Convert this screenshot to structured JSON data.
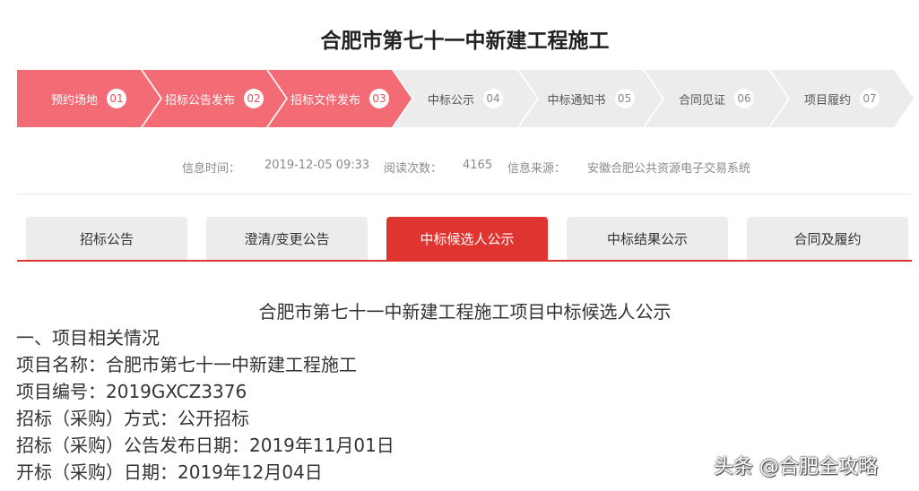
{
  "page": {
    "title": "合肥市第七十一中新建工程施工"
  },
  "steps": [
    {
      "label": "预约场地",
      "num": "01"
    },
    {
      "label": "招标公告发布",
      "num": "02"
    },
    {
      "label": "招标文件发布",
      "num": "03"
    },
    {
      "label": "中标公示",
      "num": "04"
    },
    {
      "label": "中标通知书",
      "num": "05"
    },
    {
      "label": "合同见证",
      "num": "06"
    },
    {
      "label": "项目履约",
      "num": "07"
    }
  ],
  "info": {
    "time_label": "信息时间：",
    "time_value": "2019-12-05 09:33",
    "reads_label": "阅读次数：",
    "reads_value": "4165",
    "source_label": "信息来源：",
    "source_value": "安徽合肥公共资源电子交易系统"
  },
  "tabs": [
    {
      "label": "招标公告"
    },
    {
      "label": "澄清/变更公告"
    },
    {
      "label": "中标候选人公示"
    },
    {
      "label": "中标结果公示"
    },
    {
      "label": "合同及履约"
    }
  ],
  "article": {
    "title": "合肥市第七十一中新建工程施工项目中标候选人公示",
    "lines": [
      "一、项目相关情况",
      "项目名称：合肥市第七十一中新建工程施工",
      "项目编号：2019GXCZ3376",
      "招标（采购）方式：公开招标",
      "招标（采购）公告发布日期：2019年11月01日",
      "开标（采购）日期：2019年12月04日"
    ]
  },
  "watermark": {
    "text": "头条 @合肥全攻略"
  },
  "colors": {
    "accent": "#e03430",
    "step_active": "#f26b75",
    "inactive": "#ececec"
  }
}
